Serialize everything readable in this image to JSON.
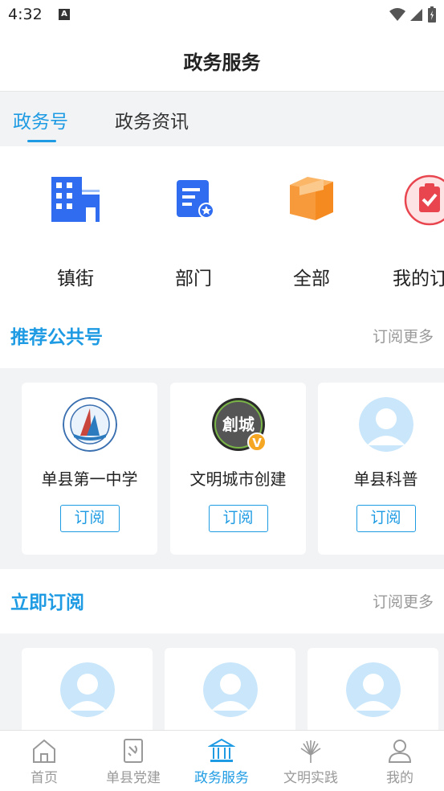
{
  "status_bar": {
    "time": "4:32",
    "notification_icon": "A"
  },
  "header": {
    "title": "政务服务"
  },
  "tabs": [
    {
      "label": "政务号",
      "active": true
    },
    {
      "label": "政务资讯",
      "active": false
    }
  ],
  "categories": [
    {
      "label": "镇街",
      "icon": "building-icon"
    },
    {
      "label": "部门",
      "icon": "department-doc-icon"
    },
    {
      "label": "全部",
      "icon": "box-icon"
    },
    {
      "label": "我的订阅",
      "icon": "clipboard-check-icon"
    }
  ],
  "recommended": {
    "title": "推荐公共号",
    "more": "订阅更多",
    "cards": [
      {
        "name": "单县第一中学",
        "button": "订阅",
        "seal_text": "山东省单县第一中学"
      },
      {
        "name": "文明城市创建",
        "button": "订阅",
        "logo_text": "創城",
        "badge": "V"
      },
      {
        "name": "单县科普",
        "button": "订阅"
      }
    ]
  },
  "subscribe_now": {
    "title": "立即订阅",
    "more": "订阅更多"
  },
  "tabbar": [
    {
      "label": "首页",
      "active": false,
      "icon": "home-icon"
    },
    {
      "label": "单县党建",
      "active": false,
      "icon": "party-book-icon"
    },
    {
      "label": "政务服务",
      "active": true,
      "icon": "government-building-icon"
    },
    {
      "label": "文明实践",
      "active": false,
      "icon": "flower-icon"
    },
    {
      "label": "我的",
      "active": false,
      "icon": "user-icon"
    }
  ],
  "colors": {
    "accent": "#1e9be3",
    "orange": "#f79a3b",
    "blue_icon": "#2f6cf0",
    "red": "#e8454f"
  }
}
